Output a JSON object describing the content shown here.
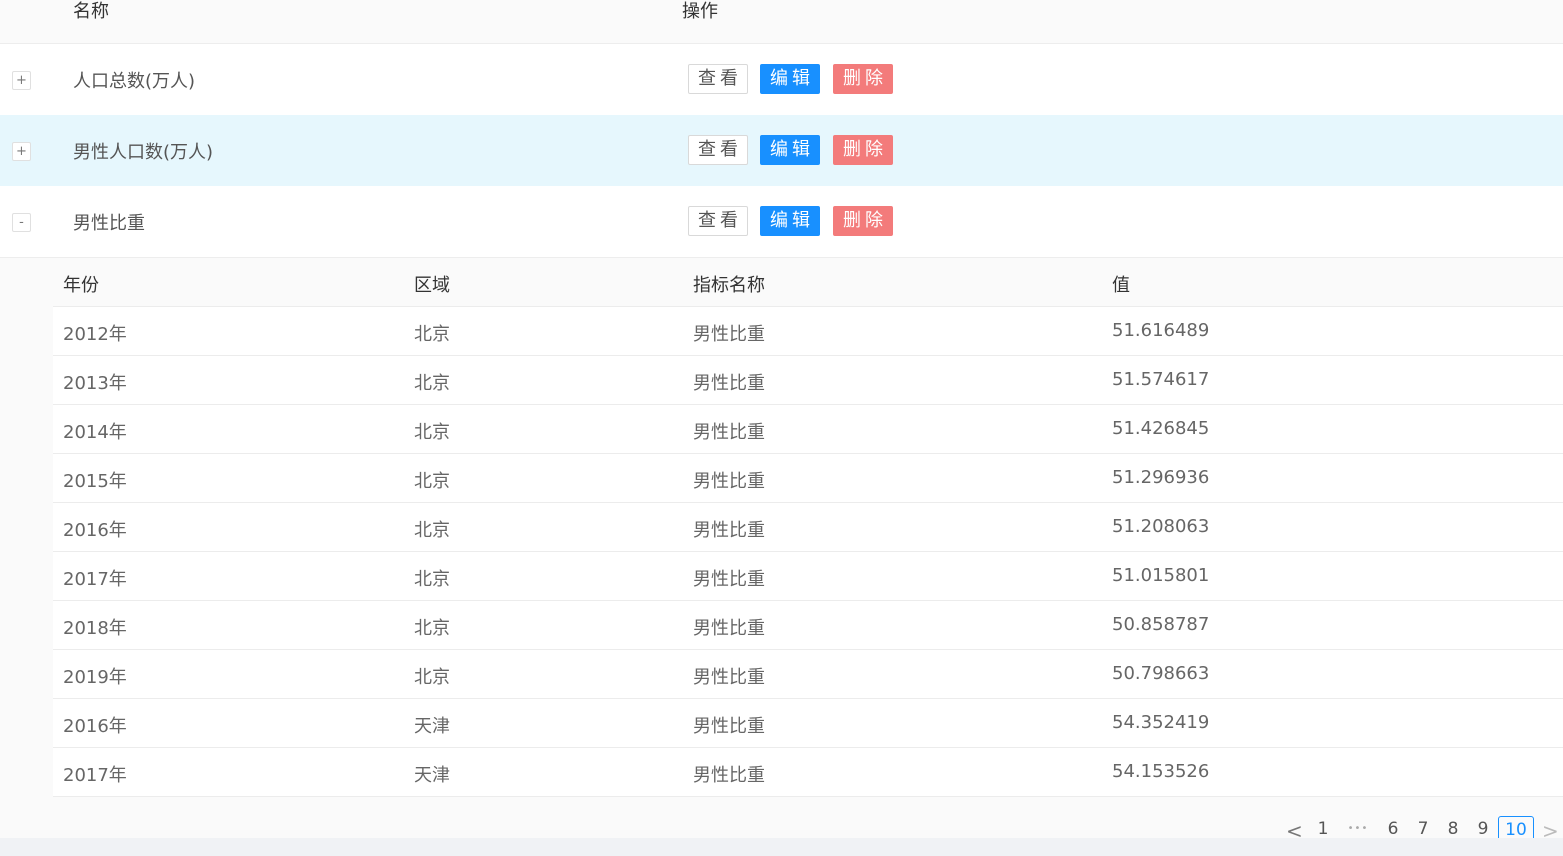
{
  "header": {
    "name_col": "名称",
    "action_col": "操作"
  },
  "buttons": {
    "view": "查看",
    "edit": "编辑",
    "delete": "删除"
  },
  "rows": [
    {
      "expand": "+",
      "name": "人口总数(万人)"
    },
    {
      "expand": "+",
      "name": "男性人口数(万人)"
    },
    {
      "expand": "-",
      "name": "男性比重"
    }
  ],
  "nested": {
    "headers": [
      "年份",
      "区域",
      "指标名称",
      "值"
    ],
    "rows": [
      [
        "2012年",
        "北京",
        "男性比重",
        "51.616489"
      ],
      [
        "2013年",
        "北京",
        "男性比重",
        "51.574617"
      ],
      [
        "2014年",
        "北京",
        "男性比重",
        "51.426845"
      ],
      [
        "2015年",
        "北京",
        "男性比重",
        "51.296936"
      ],
      [
        "2016年",
        "北京",
        "男性比重",
        "51.208063"
      ],
      [
        "2017年",
        "北京",
        "男性比重",
        "51.015801"
      ],
      [
        "2018年",
        "北京",
        "男性比重",
        "50.858787"
      ],
      [
        "2019年",
        "北京",
        "男性比重",
        "50.798663"
      ],
      [
        "2016年",
        "天津",
        "男性比重",
        "54.352419"
      ],
      [
        "2017年",
        "天津",
        "男性比重",
        "54.153526"
      ]
    ]
  },
  "pagination": {
    "prev": "<",
    "pages": [
      "1",
      "•••",
      "6",
      "7",
      "8",
      "9",
      "10"
    ],
    "current": "10",
    "next": ">"
  }
}
